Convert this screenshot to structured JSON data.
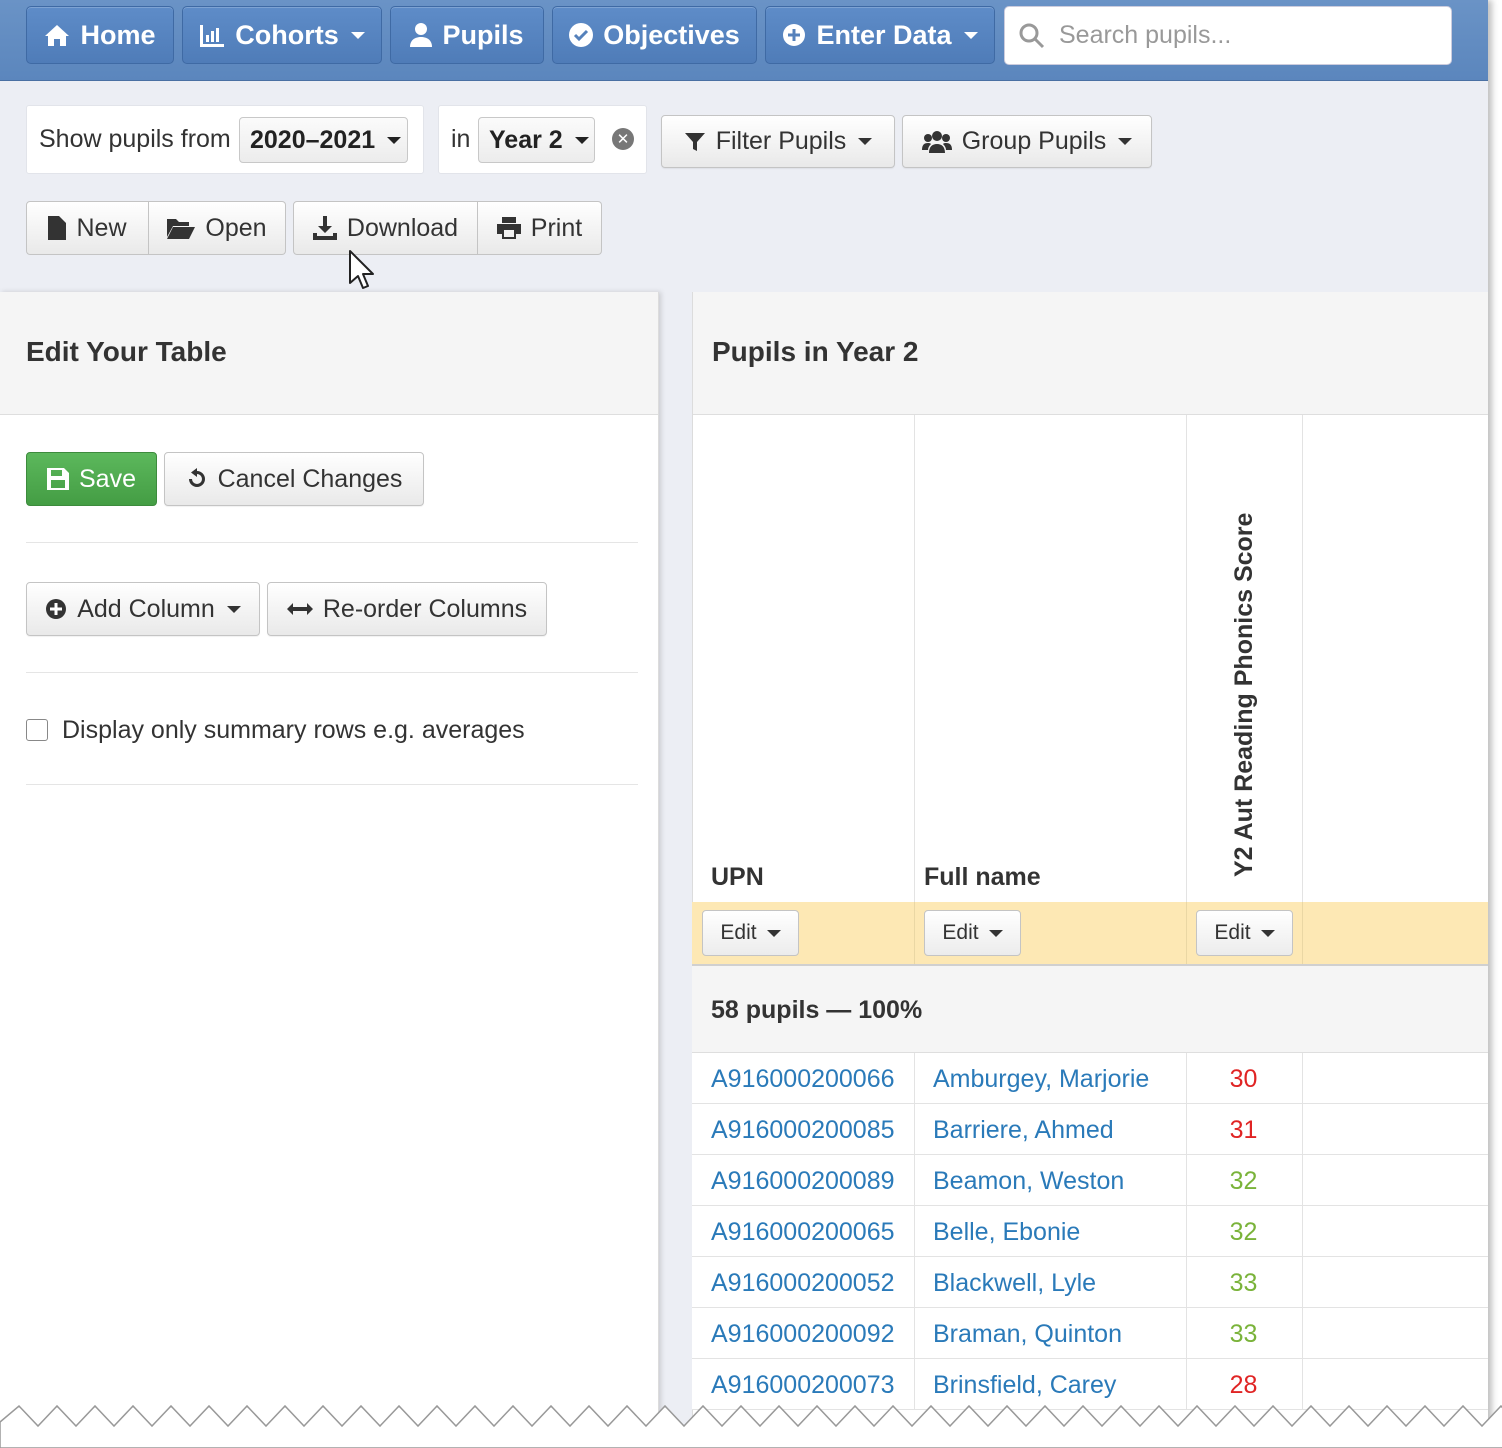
{
  "navbar": {
    "items": [
      {
        "label": "Home",
        "icon": "home-icon",
        "dropdown": false
      },
      {
        "label": "Cohorts",
        "icon": "bar-chart-icon",
        "dropdown": true
      },
      {
        "label": "Pupils",
        "icon": "user-icon",
        "dropdown": false
      },
      {
        "label": "Objectives",
        "icon": "check-circle-icon",
        "dropdown": false
      },
      {
        "label": "Enter Data",
        "icon": "plus-circle-icon",
        "dropdown": true
      }
    ],
    "search_placeholder": "Search pupils..."
  },
  "filters": {
    "show_from_label": "Show pupils from",
    "year_value": "2020–2021",
    "in_label": "in",
    "group_value": "Year 2",
    "filter_button": "Filter Pupils",
    "group_button": "Group Pupils"
  },
  "file_toolbar": {
    "new": "New",
    "open": "Open",
    "download": "Download",
    "print": "Print"
  },
  "edit_panel": {
    "title": "Edit Your Table",
    "save": "Save",
    "cancel": "Cancel Changes",
    "add_column": "Add Column",
    "reorder": "Re-order Columns",
    "summary_checkbox_label": "Display only summary rows e.g. averages",
    "summary_checked": false
  },
  "table_panel": {
    "title": "Pupils in Year 2",
    "columns": [
      "UPN",
      "Full name",
      "Y2 Aut Reading Phonics Score"
    ],
    "edit_label": "Edit",
    "summary": "58 pupils — 100%",
    "rows": [
      {
        "upn": "A916000200066",
        "name": "Amburgey, Marjorie",
        "score": "30",
        "status": "red"
      },
      {
        "upn": "A916000200085",
        "name": "Barriere, Ahmed",
        "score": "31",
        "status": "red"
      },
      {
        "upn": "A916000200089",
        "name": "Beamon, Weston",
        "score": "32",
        "status": "green"
      },
      {
        "upn": "A916000200065",
        "name": "Belle, Ebonie",
        "score": "32",
        "status": "green"
      },
      {
        "upn": "A916000200052",
        "name": "Blackwell, Lyle",
        "score": "33",
        "status": "green"
      },
      {
        "upn": "A916000200092",
        "name": "Braman, Quinton",
        "score": "33",
        "status": "green"
      },
      {
        "upn": "A916000200073",
        "name": "Brinsfield, Carey",
        "score": "28",
        "status": "red"
      }
    ]
  },
  "colors": {
    "navbar": "#5b86bd",
    "save": "#5cb85c",
    "link": "#2a7ab9",
    "score_low": "#e02424",
    "score_ok": "#7ab33a",
    "edit_row": "#fde8b4"
  }
}
